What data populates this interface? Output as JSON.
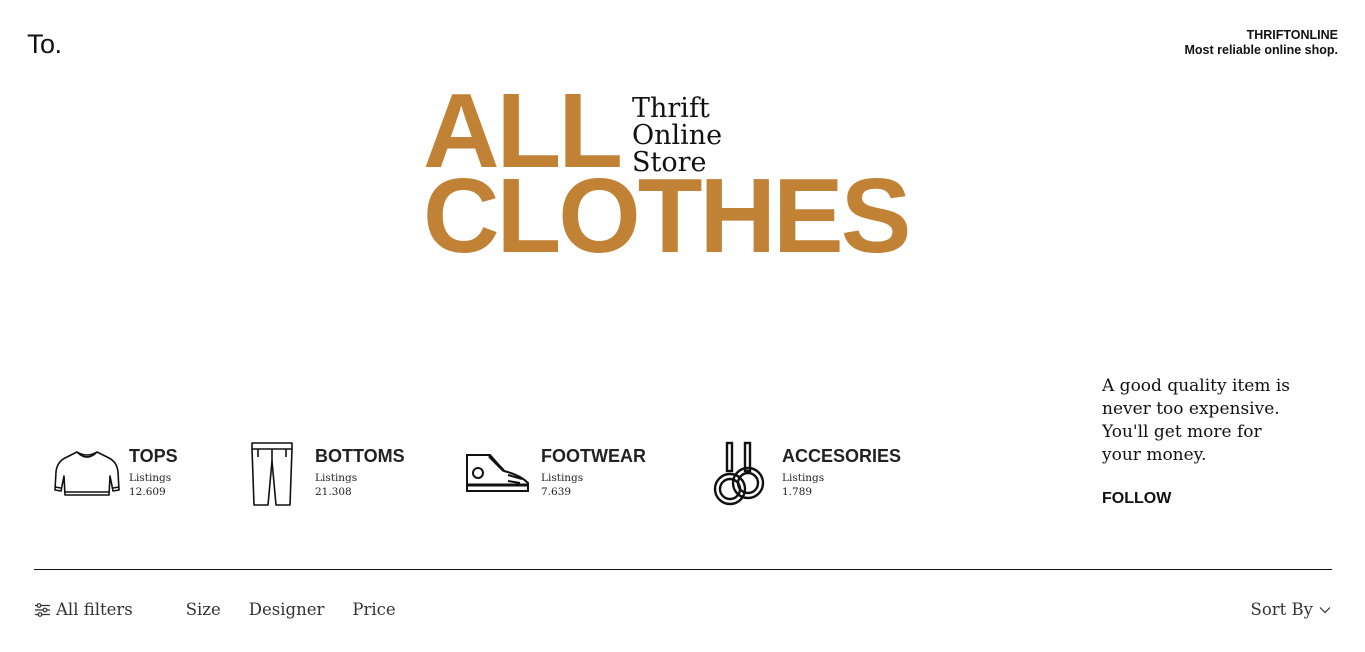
{
  "header": {
    "logo": "To.",
    "brand_name": "THRIFTONLINE",
    "tagline": "Most reliable online shop."
  },
  "hero": {
    "big_line_1": "ALL",
    "big_line_2": "CLOTHES",
    "small_lines": [
      "Thrift",
      "Online",
      "Store"
    ],
    "accent_color": "#c28235"
  },
  "categories": [
    {
      "title": "TOPS",
      "listings_label": "Listings",
      "listings_count": "12.609",
      "icon": "sweater-icon"
    },
    {
      "title": "BOTTOMS",
      "listings_label": "Listings",
      "listings_count": "21.308",
      "icon": "pants-icon"
    },
    {
      "title": "FOOTWEAR",
      "listings_label": "Listings",
      "listings_count": "7.639",
      "icon": "sneaker-icon"
    },
    {
      "title": "ACCESORIES",
      "listings_label": "Listings",
      "listings_count": "1.789",
      "icon": "rings-icon"
    }
  ],
  "promo": {
    "quote_lines": [
      "A good quality item is",
      "never too expensive.",
      "You'll get more for",
      "your money."
    ],
    "follow_label": "FOLLOW"
  },
  "filters": {
    "all_filters_label": "All filters",
    "items": [
      "Size",
      "Designer",
      "Price"
    ],
    "sort_label": "Sort By"
  }
}
